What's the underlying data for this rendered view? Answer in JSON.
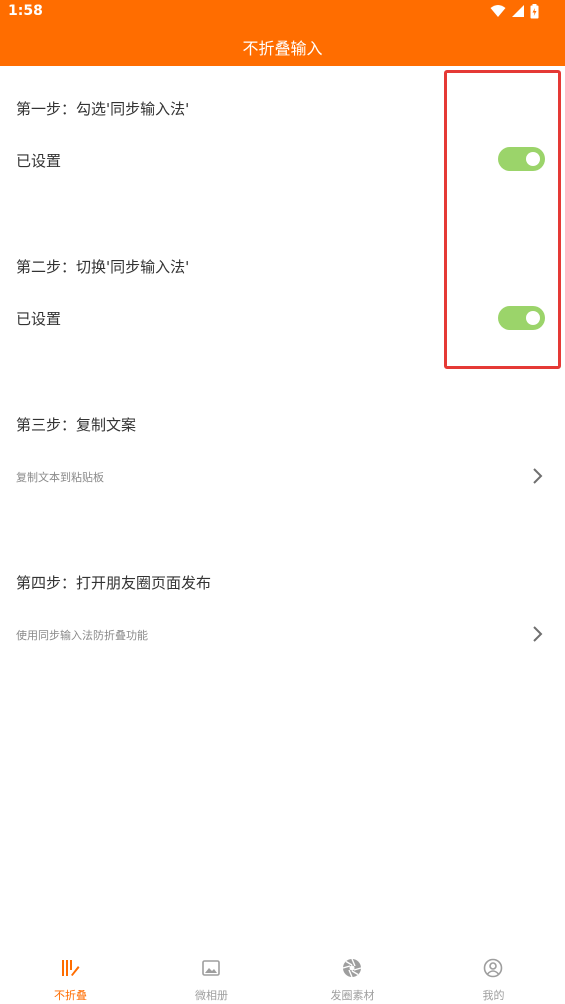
{
  "status_bar": {
    "time": "1:58"
  },
  "header": {
    "title": "不折叠输入",
    "color": "#ff6d00"
  },
  "steps": [
    {
      "title": "第一步：勾选'同步输入法'",
      "row_label": "已设置",
      "toggle_on": true
    },
    {
      "title": "第二步：切换'同步输入法'",
      "row_label": "已设置",
      "toggle_on": true
    },
    {
      "title": "第三步：复制文案",
      "row_label": "复制文本到粘贴板",
      "action_icon": "chevron-right-icon"
    },
    {
      "title": "第四步：打开朋友圈页面发布",
      "row_label": "使用同步输入法防折叠功能",
      "action_icon": "chevron-right-icon"
    }
  ],
  "toggle_color": "#9bd46a",
  "highlight_color": "#e53935",
  "bottom_nav": {
    "items": [
      {
        "label": "不折叠",
        "icon": "no-fold-icon",
        "active": true
      },
      {
        "label": "微相册",
        "icon": "image-icon",
        "active": false
      },
      {
        "label": "发圈素材",
        "icon": "aperture-icon",
        "active": false
      },
      {
        "label": "我的",
        "icon": "user-icon",
        "active": false
      }
    ]
  }
}
